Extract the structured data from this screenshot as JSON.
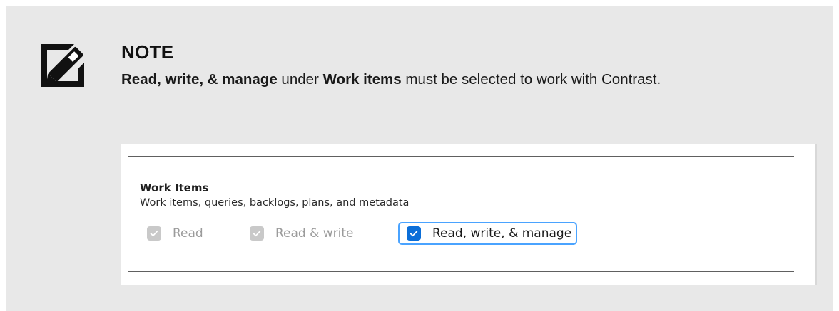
{
  "note": {
    "title": "NOTE",
    "bold_1": "Read, write, & manage",
    "text_1": " under ",
    "bold_2": "Work items",
    "text_2": " must be selected to work with Contrast.",
    "icon": "note-icon"
  },
  "screenshot": {
    "section_title": "Work Items",
    "section_description": "Work items, queries, backlogs, plans, and metadata",
    "options": [
      {
        "label": "Read",
        "checked": true,
        "disabled": true
      },
      {
        "label": "Read & write",
        "checked": true,
        "disabled": true
      },
      {
        "label": "Read, write, & manage",
        "checked": true,
        "disabled": false,
        "focused": true
      }
    ],
    "accent_color": "#0b6ed8",
    "focus_color": "#4aa3ff"
  }
}
